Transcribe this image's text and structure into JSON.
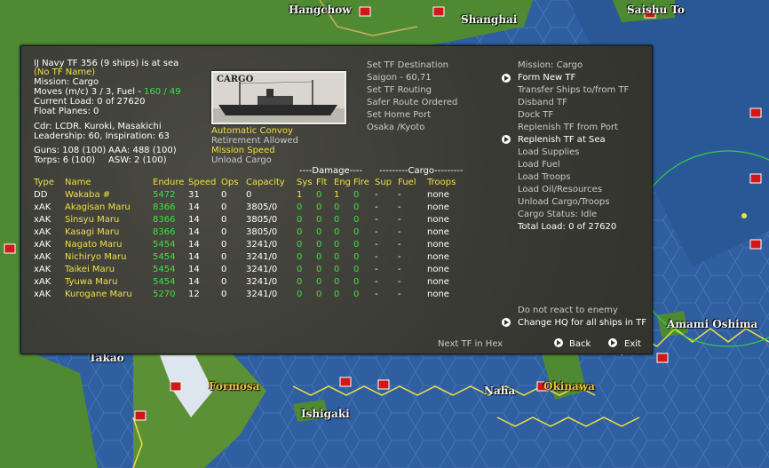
{
  "map": {
    "labels": {
      "hangchow": "Hangchow",
      "shanghai": "Shanghai",
      "saishu_to": "Saishu To",
      "takao": "Takao",
      "formosa": "Formosa",
      "ishigaki": "Ishigaki",
      "naha": "Naha",
      "okinawa": "Okinawa",
      "amami_oshima": "Amami Oshima"
    }
  },
  "tf": {
    "header": "IJ Navy TF 356 (9 ships) is at sea",
    "name": "(No TF Name)",
    "mission": "Mission: Cargo",
    "moves_label": "Moves (m/c)  3 / 3, Fuel - ",
    "fuel": "160 / 49",
    "current_load": "Current Load: 0 of 27620",
    "float_planes": "Float Planes: 0",
    "cdr": "Cdr: LCDR. Kuroki, Masakichi",
    "leadership": "Leadership: 60, Inspiration: 63",
    "guns": "Guns: 108 (100)",
    "aaa": "AAA: 488 (100)",
    "torps": "Torps: 6 (100)",
    "asw": "ASW: 2 (100)"
  },
  "image": {
    "label": "CARGO"
  },
  "options": {
    "automatic_convoy": "Automatic Convoy",
    "retirement_allowed": "Retirement Allowed",
    "mission_speed": "Mission Speed",
    "unload_cargo": "Unload Cargo"
  },
  "destination": {
    "set_tf_destination": "Set TF Destination",
    "destination_value": "Saigon - 60,71",
    "set_tf_routing": "Set TF Routing",
    "routing_value": "Safer Route Ordered",
    "set_home_port": "Set Home Port",
    "home_port_value": "Osaka /Kyoto"
  },
  "right_menu": {
    "mission": "Mission: Cargo",
    "form_new_tf": "Form New TF",
    "transfer_ships": "Transfer Ships to/from TF",
    "disband_tf": "Disband TF",
    "dock_tf": "Dock TF",
    "replenish_port": "Replenish TF from Port",
    "replenish_sea": "Replenish TF at Sea",
    "load_supplies": "Load Supplies",
    "load_fuel": "Load Fuel",
    "load_troops": "Load Troops",
    "load_oil": "Load Oil/Resources",
    "unload_cargo_troops": "Unload Cargo/Troops",
    "cargo_status": "Cargo Status: Idle",
    "total_load": "Total Load: 0 of 27620",
    "do_not_react": "Do not react to enemy",
    "change_hq": "Change HQ for all ships in TF"
  },
  "bottom": {
    "next_tf": "Next TF in Hex",
    "back": "Back",
    "exit": "Exit"
  },
  "table": {
    "group_damage": "----Damage----",
    "group_cargo": "---------Cargo---------",
    "headers": [
      "Type",
      "Name",
      "Endure",
      "Speed",
      "Ops",
      "Capacity",
      "Sys",
      "Flt",
      "Eng",
      "Fire",
      "Sup",
      "Fuel",
      "Troops"
    ],
    "rows": [
      {
        "type": "DD",
        "name": "Wakaba #",
        "endure": "5472",
        "speed": "31",
        "ops": "0",
        "capacity": "0",
        "sys": "1",
        "flt": "0",
        "eng": "1",
        "fire": "0",
        "sup": "-",
        "fuel": "-",
        "troops": "none"
      },
      {
        "type": "xAK",
        "name": "Akagisan Maru",
        "endure": "8366",
        "speed": "14",
        "ops": "0",
        "capacity": "3805/0",
        "sys": "0",
        "flt": "0",
        "eng": "0",
        "fire": "0",
        "sup": "-",
        "fuel": "-",
        "troops": "none"
      },
      {
        "type": "xAK",
        "name": "Sinsyu Maru",
        "endure": "8366",
        "speed": "14",
        "ops": "0",
        "capacity": "3805/0",
        "sys": "0",
        "flt": "0",
        "eng": "0",
        "fire": "0",
        "sup": "-",
        "fuel": "-",
        "troops": "none"
      },
      {
        "type": "xAK",
        "name": "Kasagi Maru",
        "endure": "8366",
        "speed": "14",
        "ops": "0",
        "capacity": "3805/0",
        "sys": "0",
        "flt": "0",
        "eng": "0",
        "fire": "0",
        "sup": "-",
        "fuel": "-",
        "troops": "none"
      },
      {
        "type": "xAK",
        "name": "Nagato Maru",
        "endure": "5454",
        "speed": "14",
        "ops": "0",
        "capacity": "3241/0",
        "sys": "0",
        "flt": "0",
        "eng": "0",
        "fire": "0",
        "sup": "-",
        "fuel": "-",
        "troops": "none"
      },
      {
        "type": "xAK",
        "name": "Nichiryo Maru",
        "endure": "5454",
        "speed": "14",
        "ops": "0",
        "capacity": "3241/0",
        "sys": "0",
        "flt": "0",
        "eng": "0",
        "fire": "0",
        "sup": "-",
        "fuel": "-",
        "troops": "none"
      },
      {
        "type": "xAK",
        "name": "Taikei Maru",
        "endure": "5454",
        "speed": "14",
        "ops": "0",
        "capacity": "3241/0",
        "sys": "0",
        "flt": "0",
        "eng": "0",
        "fire": "0",
        "sup": "-",
        "fuel": "-",
        "troops": "none"
      },
      {
        "type": "xAK",
        "name": "Tyuwa Maru",
        "endure": "5454",
        "speed": "14",
        "ops": "0",
        "capacity": "3241/0",
        "sys": "0",
        "flt": "0",
        "eng": "0",
        "fire": "0",
        "sup": "-",
        "fuel": "-",
        "troops": "none"
      },
      {
        "type": "xAK",
        "name": "Kurogane Maru",
        "endure": "5270",
        "speed": "12",
        "ops": "0",
        "capacity": "3241/0",
        "sys": "0",
        "flt": "0",
        "eng": "0",
        "fire": "0",
        "sup": "-",
        "fuel": "-",
        "troops": "none"
      }
    ]
  },
  "colors": {
    "yellow": "#f0e040",
    "green": "#40e040",
    "panel": "#3e3e38",
    "sea": "#2f5fa0",
    "land": "#4f8a32"
  }
}
